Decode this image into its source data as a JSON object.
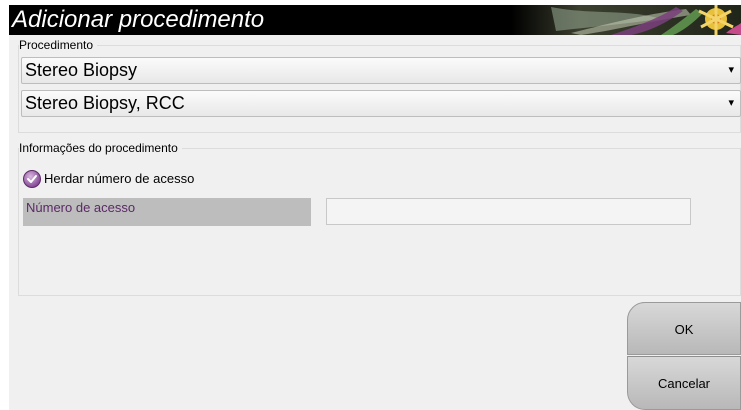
{
  "dialog": {
    "title": "Adicionar procedimento"
  },
  "procedure_group": {
    "legend": "Procedimento",
    "procedure_select": {
      "value": "Stereo Biopsy"
    },
    "view_select": {
      "value": "Stereo Biopsy, RCC"
    }
  },
  "info_group": {
    "legend": "Informações do procedimento",
    "inherit_checkbox": {
      "label": "Herdar número de acesso",
      "checked": true
    },
    "accession": {
      "label": "Número de acesso",
      "value": ""
    }
  },
  "buttons": {
    "ok_label": "OK",
    "cancel_label": "Cancelar"
  },
  "colors": {
    "title_bar": "#000000",
    "accent_purple": "#8a4f9a",
    "label_purple": "#5a2a66"
  },
  "icons": {
    "check": "check-icon",
    "dropdown": "chevron-down-icon"
  }
}
